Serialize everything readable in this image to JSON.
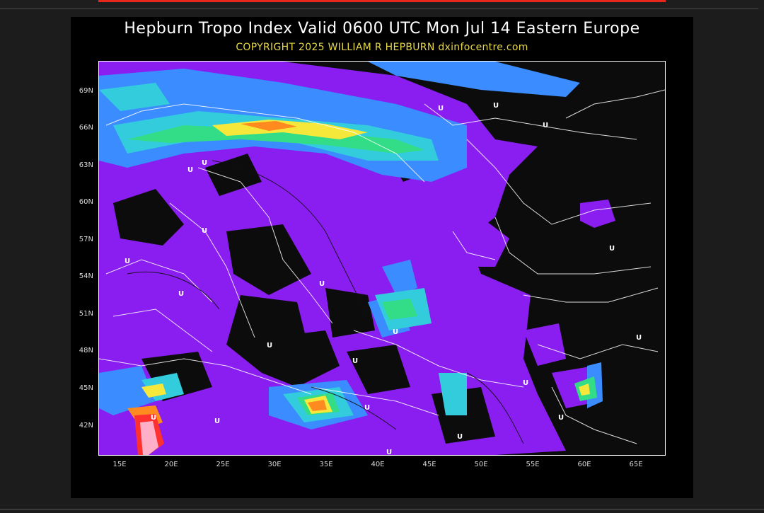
{
  "header": {
    "title": "Hepburn Tropo Index Valid 0600 UTC Mon Jul 14 Eastern Europe",
    "copyright": "COPYRIGHT 2025   WILLIAM R HEPBURN   dxinfocentre.com"
  },
  "map": {
    "lat_labels": [
      "69N",
      "66N",
      "63N",
      "60N",
      "57N",
      "54N",
      "51N",
      "48N",
      "45N",
      "42N"
    ],
    "lon_labels": [
      "15E",
      "20E",
      "25E",
      "30E",
      "35E",
      "40E",
      "45E",
      "50E",
      "55E",
      "60E",
      "65E"
    ],
    "pressure_marker": "U",
    "colors": {
      "black": "#0c0c0c",
      "purple": "#8a1ef0",
      "blue": "#3a8cff",
      "cyan": "#33ccdd",
      "green": "#33dd88",
      "yellow": "#f5e83a",
      "orange": "#ff8a20",
      "red": "#ff3030",
      "pink": "#ffb0c8"
    }
  }
}
